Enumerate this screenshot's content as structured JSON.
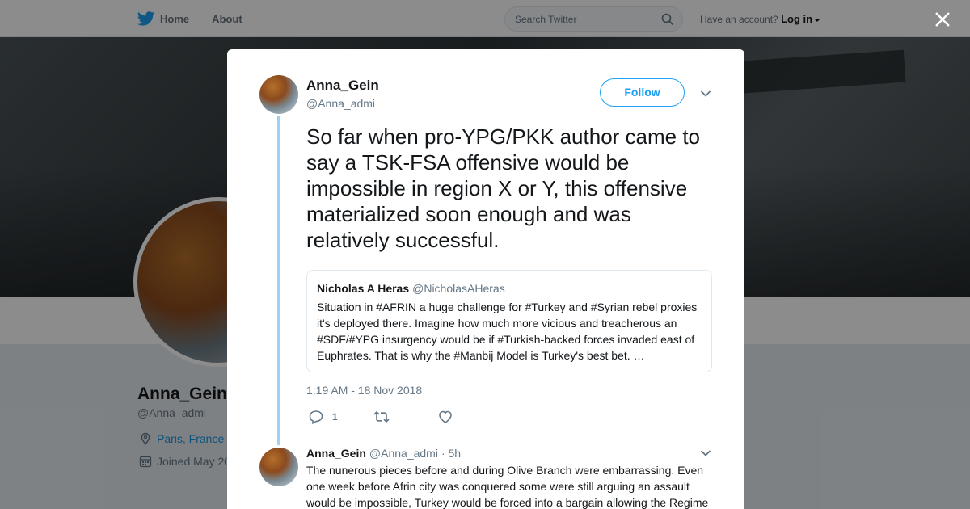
{
  "nav": {
    "home_label": "Home",
    "about_label": "About",
    "search_placeholder": "Search Twitter",
    "account_prompt": "Have an account?",
    "login_label": "Log in"
  },
  "profile": {
    "name": "Anna_Gein",
    "handle": "@Anna_admi",
    "location": "Paris, France",
    "joined": "Joined May 20"
  },
  "tweet": {
    "author_name": "Anna_Gein",
    "author_handle": "@Anna_admi",
    "follow_label": "Follow",
    "text": "So far when pro-YPG/PKK author came to say a TSK-FSA offensive would be impossible in region X or Y, this offensive materialized soon enough and was relatively successful.",
    "quote": {
      "name": "Nicholas A Heras",
      "handle": "@NicholasAHeras",
      "text": "Situation in #AFRIN a huge challenge for #Turkey and #Syrian rebel proxies it's deployed there. Imagine how much more vicious and treacherous an #SDF/#YPG insurgency would be if #Turkish-backed forces invaded east of Euphrates. That is why the #Manbij Model is Turkey's best bet. …"
    },
    "timestamp": "1:19 AM - 18 Nov 2018",
    "reply_count": "1"
  },
  "reply": {
    "author_name": "Anna_Gein",
    "author_handle": "@Anna_admi",
    "age": "· 5h",
    "text": "The nunerous pieces before and during Olive Branch were embarrassing. Even one week before Afrin city was conquered some were still arguing an assault would be impossible, Turkey would be forced into a bargain allowing the Regime"
  },
  "colors": {
    "accent": "#1da1f2",
    "thread_line": "#9fd1f2"
  }
}
